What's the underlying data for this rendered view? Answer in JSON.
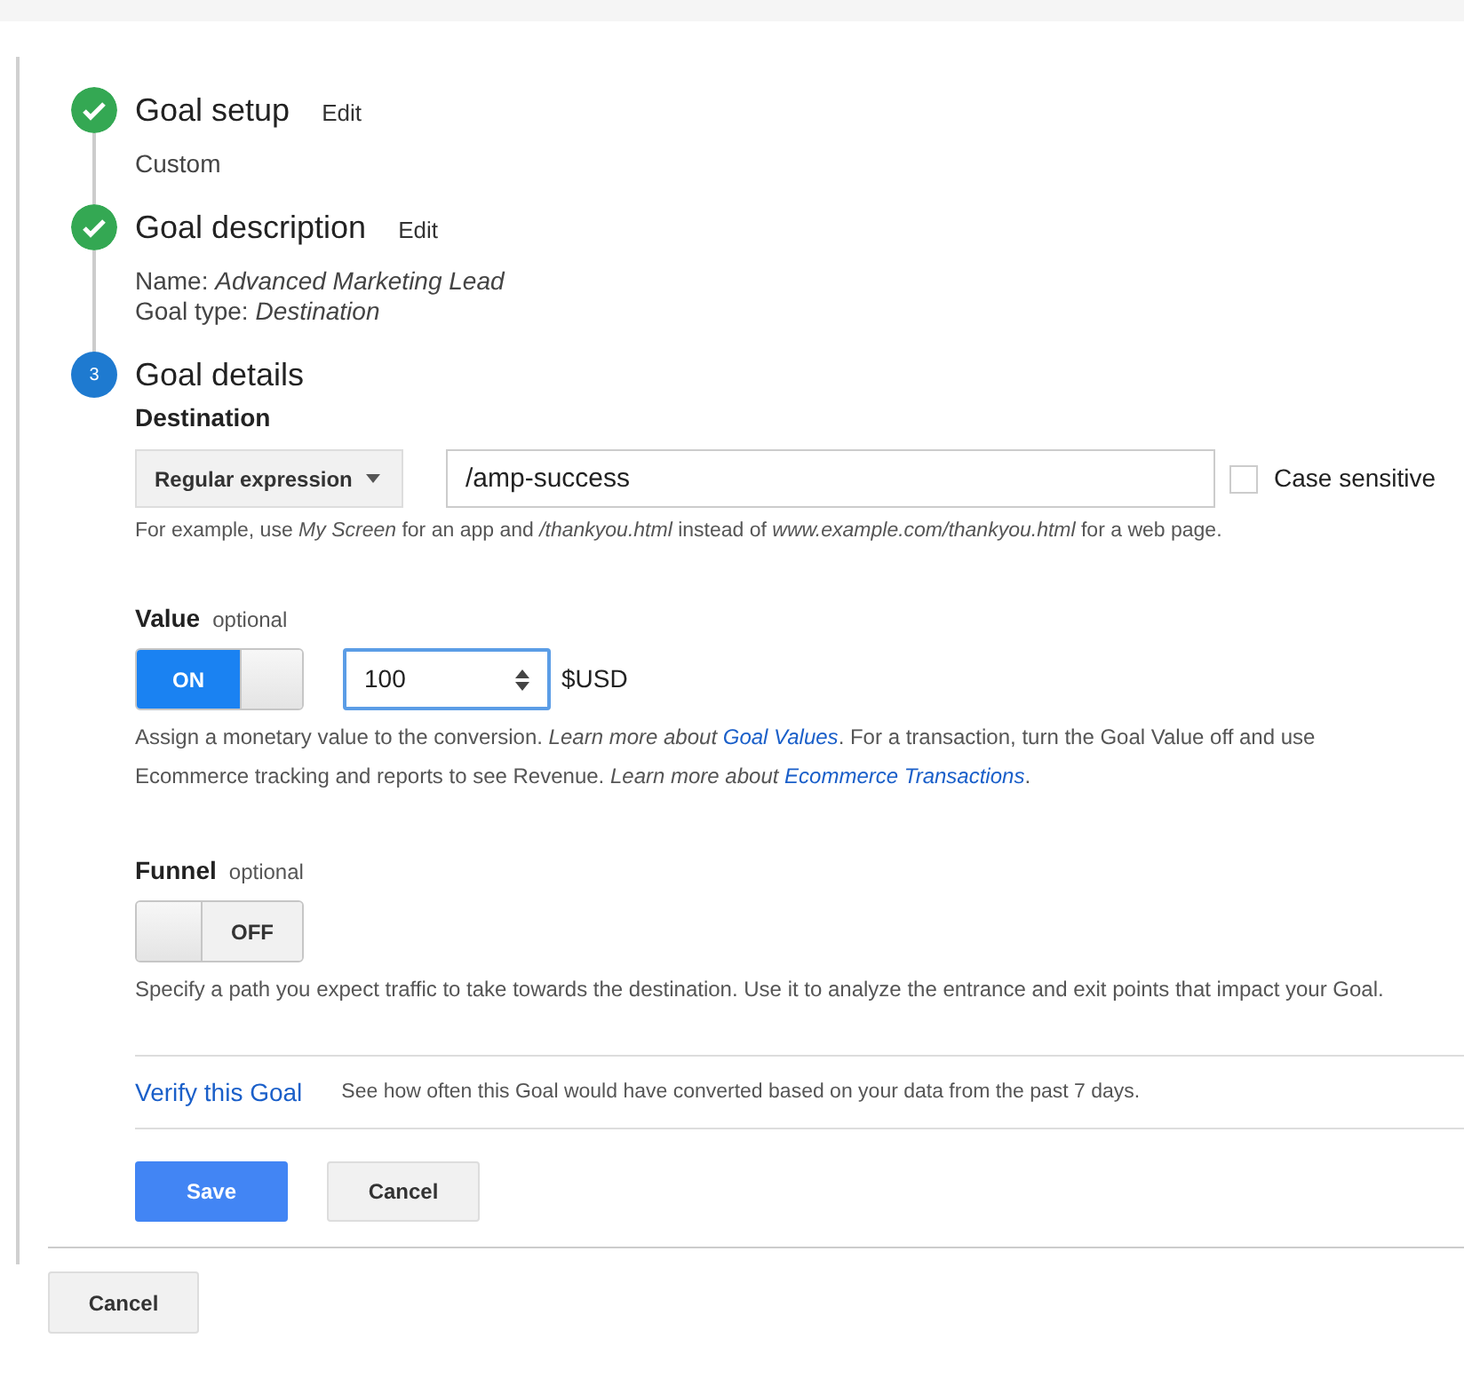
{
  "steps": [
    {
      "kind": "done",
      "title": "Goal setup",
      "edit": "Edit",
      "lines": [
        "Custom"
      ]
    },
    {
      "kind": "done",
      "title": "Goal description",
      "edit": "Edit",
      "lines": [
        "Name: *Advanced Marketing Lead*",
        "Goal type: *Destination*"
      ]
    },
    {
      "kind": "current",
      "number": "3",
      "title": "Goal details"
    }
  ],
  "destination": {
    "label": "Destination",
    "match_type": "Regular expression",
    "value": "/amp-success",
    "case_sensitive": {
      "label": "Case sensitive",
      "checked": false
    },
    "hint": "For example, use *My Screen* for an app and */thankyou.html* instead of *www.example.com/thankyou.html* for a web page."
  },
  "value": {
    "label": "Value",
    "optional": "optional",
    "toggle": {
      "on": true,
      "label": "ON"
    },
    "amount": "100",
    "currency": "$USD",
    "description": [
      {
        "kind": "text",
        "text": "Assign a monetary value to the conversion. *Learn more about* "
      },
      {
        "kind": "link",
        "text": "Goal Values"
      },
      {
        "kind": "text",
        "text": ". For a transaction, turn the Goal Value off and use Ecommerce tracking and reports to see Revenue. *Learn more about* "
      },
      {
        "kind": "link",
        "text": "Ecommerce Transactions"
      },
      {
        "kind": "text",
        "text": "."
      }
    ]
  },
  "funnel": {
    "label": "Funnel",
    "optional": "optional",
    "toggle": {
      "on": false,
      "label": "OFF"
    },
    "description": [
      {
        "kind": "text",
        "text": "Specify a path you expect traffic to take towards the destination. Use it to analyze the entrance and exit points that impact your Goal."
      }
    ]
  },
  "verify": {
    "link": "Verify this Goal",
    "text": "See how often this Goal would have converted based on your data from the past 7 days."
  },
  "buttons": {
    "save": "Save",
    "cancel": "Cancel"
  },
  "footer_cancel": "Cancel"
}
